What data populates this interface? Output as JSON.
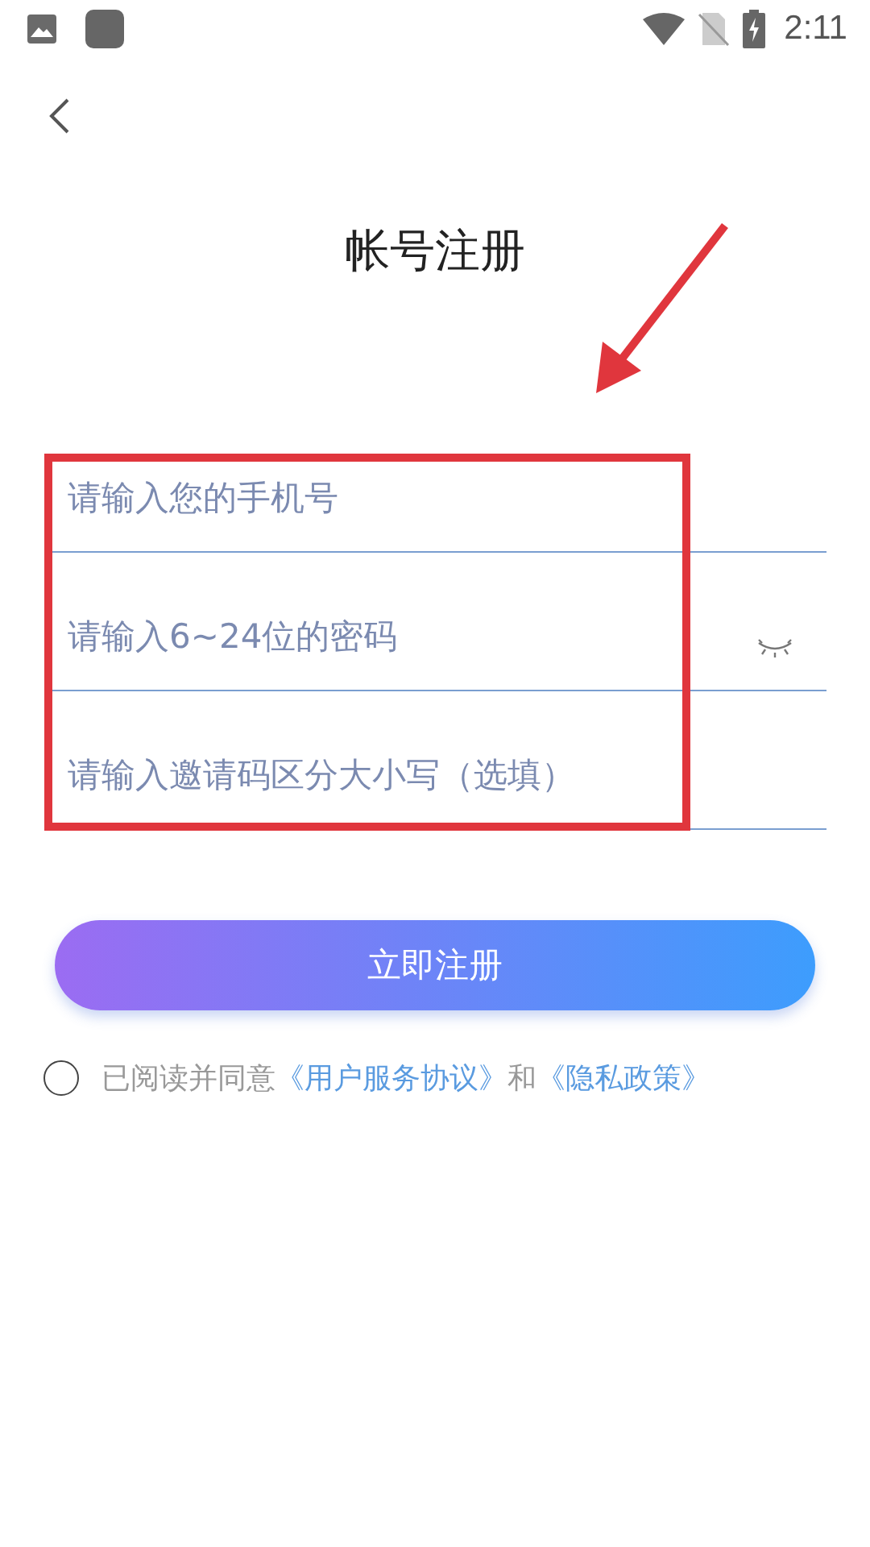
{
  "status_bar": {
    "time": "2:11"
  },
  "title": "帐号注册",
  "fields": [
    {
      "kind": "phone",
      "placeholder": "请输入您的手机号"
    },
    {
      "kind": "password",
      "placeholder": "请输入6~24位的密码",
      "password_visible": false
    },
    {
      "kind": "invite",
      "placeholder": "请输入邀请码区分大小写（选填）"
    }
  ],
  "submit_button": "立即注册",
  "agreement": {
    "checked": false,
    "parts": [
      {
        "kind": "text",
        "text": "已阅读并同意"
      },
      {
        "kind": "link",
        "text": "《用户服务协议》"
      },
      {
        "kind": "text",
        "text": "和"
      },
      {
        "kind": "link",
        "text": "《隐私政策》"
      }
    ]
  }
}
